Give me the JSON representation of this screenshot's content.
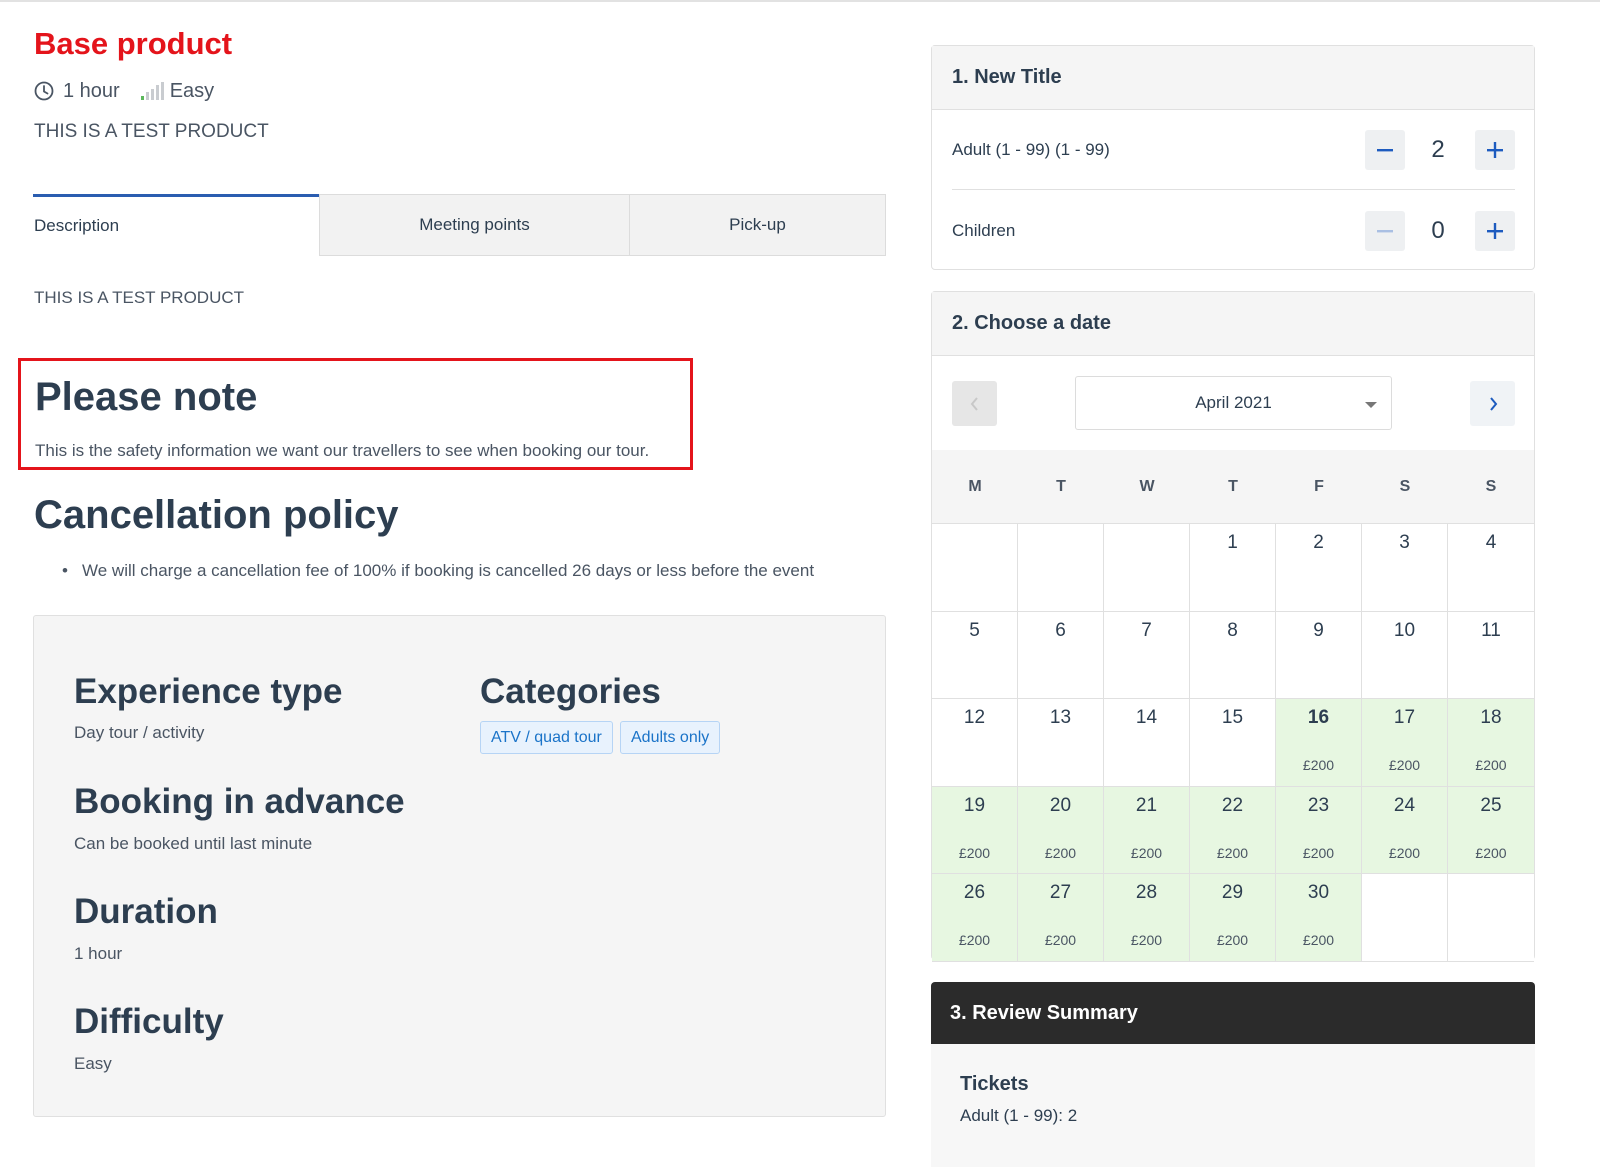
{
  "product": {
    "title": "Base product",
    "duration": "1 hour",
    "difficulty": "Easy",
    "tagline": "THIS IS A TEST PRODUCT"
  },
  "tabs": [
    {
      "label": "Description",
      "active": true
    },
    {
      "label": "Meeting points",
      "active": false
    },
    {
      "label": "Pick-up",
      "active": false
    }
  ],
  "description_text": "THIS IS A TEST PRODUCT",
  "note": {
    "title": "Please note",
    "text": "This is the safety information we want our travellers to see when booking our tour."
  },
  "cancellation": {
    "title": "Cancellation policy",
    "items": [
      "We will charge a cancellation fee of 100% if booking is cancelled 26 days or less before the event"
    ]
  },
  "info": {
    "experience_type": {
      "heading": "Experience type",
      "value": "Day tour / activity"
    },
    "booking_in_advance": {
      "heading": "Booking in advance",
      "value": "Can be booked until last minute"
    },
    "duration": {
      "heading": "Duration",
      "value": "1 hour"
    },
    "difficulty": {
      "heading": "Difficulty",
      "value": "Easy"
    },
    "categories": {
      "heading": "Categories",
      "items": [
        "ATV / quad tour",
        "Adults only"
      ]
    }
  },
  "step1": {
    "title": "1. New Title",
    "rows": [
      {
        "label": "Adult (1 - 99) (1 - 99)",
        "value": "2"
      },
      {
        "label": "Children",
        "value": "0"
      }
    ]
  },
  "step2": {
    "title": "2. Choose a date",
    "month": "April 2021",
    "weekdays": [
      "M",
      "T",
      "W",
      "T",
      "F",
      "S",
      "S"
    ],
    "days": [
      {
        "num": "",
        "price": ""
      },
      {
        "num": "",
        "price": ""
      },
      {
        "num": "",
        "price": ""
      },
      {
        "num": "1",
        "price": ""
      },
      {
        "num": "2",
        "price": ""
      },
      {
        "num": "3",
        "price": ""
      },
      {
        "num": "4",
        "price": ""
      },
      {
        "num": "5",
        "price": ""
      },
      {
        "num": "6",
        "price": ""
      },
      {
        "num": "7",
        "price": ""
      },
      {
        "num": "8",
        "price": ""
      },
      {
        "num": "9",
        "price": ""
      },
      {
        "num": "10",
        "price": ""
      },
      {
        "num": "11",
        "price": ""
      },
      {
        "num": "12",
        "price": ""
      },
      {
        "num": "13",
        "price": ""
      },
      {
        "num": "14",
        "price": ""
      },
      {
        "num": "15",
        "price": ""
      },
      {
        "num": "16",
        "price": "£200",
        "bold": true
      },
      {
        "num": "17",
        "price": "£200"
      },
      {
        "num": "18",
        "price": "£200"
      },
      {
        "num": "19",
        "price": "£200"
      },
      {
        "num": "20",
        "price": "£200"
      },
      {
        "num": "21",
        "price": "£200"
      },
      {
        "num": "22",
        "price": "£200"
      },
      {
        "num": "23",
        "price": "£200"
      },
      {
        "num": "24",
        "price": "£200"
      },
      {
        "num": "25",
        "price": "£200"
      },
      {
        "num": "26",
        "price": "£200"
      },
      {
        "num": "27",
        "price": "£200"
      },
      {
        "num": "28",
        "price": "£200"
      },
      {
        "num": "29",
        "price": "£200"
      },
      {
        "num": "30",
        "price": "£200"
      },
      {
        "num": "",
        "price": ""
      },
      {
        "num": "",
        "price": ""
      }
    ]
  },
  "step3": {
    "title": "3. Review Summary",
    "tickets_label": "Tickets",
    "tickets_line": "Adult (1 - 99): 2"
  },
  "colors": {
    "title_red": "#e4141b",
    "accent_blue": "#1a73c8",
    "available_green": "#e7f7e1",
    "summary_dark": "#2b2b2b"
  }
}
